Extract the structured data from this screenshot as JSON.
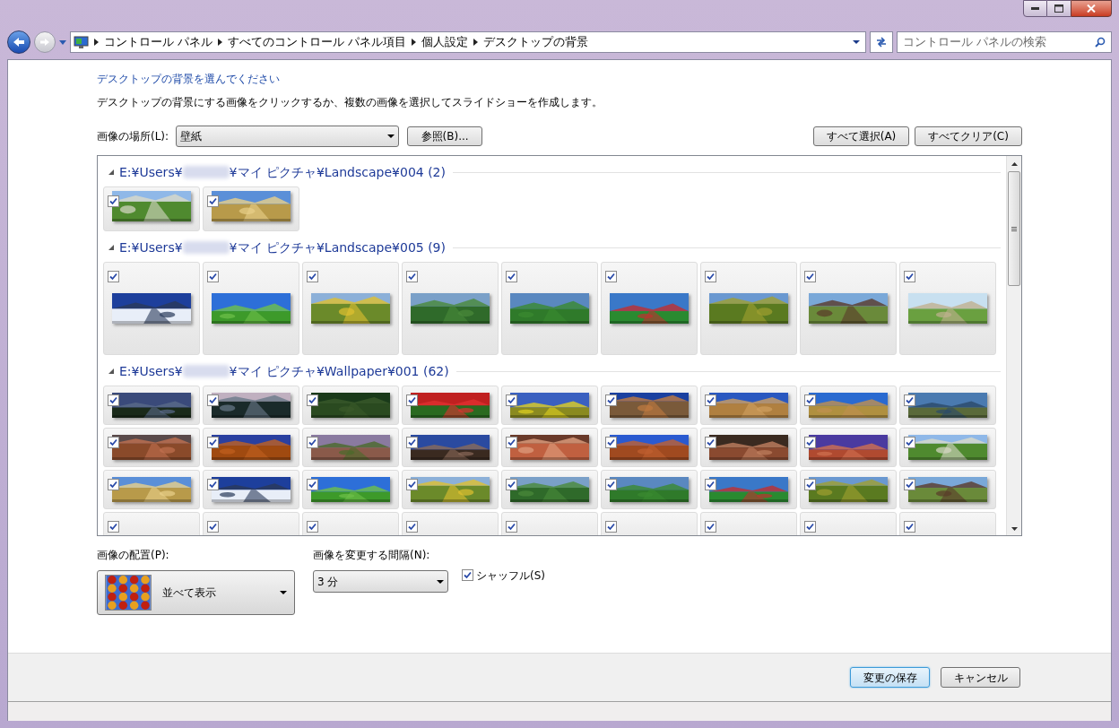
{
  "address_bar": {
    "breadcrumbs": [
      "コントロール パネル",
      "すべてのコントロール パネル項目",
      "個人設定",
      "デスクトップの背景"
    ]
  },
  "search": {
    "placeholder": "コントロール パネルの検索"
  },
  "heading": "デスクトップの背景を選んでください",
  "instructions": "デスクトップの背景にする画像をクリックするか、複数の画像を選択してスライドショーを作成します。",
  "location": {
    "label": "画像の場所(L):",
    "value": "壁紙",
    "browse": "参照(B)..."
  },
  "select_all": "すべて選択(A)",
  "clear_all": "すべてクリア(C)",
  "groups": [
    {
      "path_start": "E:¥Users¥",
      "path_end": "¥マイ ピクチャ¥Landscape¥004 (2)",
      "expanded": true,
      "kind": "short",
      "items": [
        {
          "checked": true,
          "kind": "thumb"
        },
        {
          "checked": true,
          "kind": "thumb"
        }
      ]
    },
    {
      "path_start": "E:¥Users¥",
      "path_end": "¥マイ ピクチャ¥Landscape¥005 (9)",
      "expanded": true,
      "kind": "tall",
      "items": [
        {
          "checked": true,
          "kind": "thumb"
        },
        {
          "checked": true,
          "kind": "thumb"
        },
        {
          "checked": true,
          "kind": "thumb"
        },
        {
          "checked": true,
          "kind": "thumb"
        },
        {
          "checked": true,
          "kind": "thumb"
        },
        {
          "checked": true,
          "kind": "thumb"
        },
        {
          "checked": true,
          "kind": "thumb"
        },
        {
          "checked": true,
          "kind": "thumb"
        },
        {
          "checked": true,
          "kind": "thumb"
        }
      ]
    },
    {
      "path_start": "E:¥Users¥",
      "path_end": "¥マイ ピクチャ¥Wallpaper¥001 (62)",
      "expanded": true,
      "kind": "compact",
      "items": [
        {
          "checked": true,
          "kind": "thumb"
        },
        {
          "checked": true,
          "kind": "thumb"
        },
        {
          "checked": true,
          "kind": "thumb"
        },
        {
          "checked": true,
          "kind": "thumb"
        },
        {
          "checked": true,
          "kind": "thumb"
        },
        {
          "checked": true,
          "kind": "thumb"
        },
        {
          "checked": true,
          "kind": "thumb"
        },
        {
          "checked": true,
          "kind": "thumb"
        },
        {
          "checked": true,
          "kind": "thumb"
        },
        {
          "checked": true,
          "kind": "thumb"
        },
        {
          "checked": true,
          "kind": "thumb"
        },
        {
          "checked": true,
          "kind": "thumb"
        },
        {
          "checked": true,
          "kind": "thumb"
        },
        {
          "checked": true,
          "kind": "thumb"
        },
        {
          "checked": true,
          "kind": "thumb"
        },
        {
          "checked": true,
          "kind": "thumb"
        },
        {
          "checked": true,
          "kind": "thumb"
        },
        {
          "checked": true,
          "kind": "thumb"
        },
        {
          "checked": true,
          "kind": "thumb"
        },
        {
          "checked": true,
          "kind": "thumb"
        },
        {
          "checked": true,
          "kind": "thumb"
        },
        {
          "checked": true,
          "kind": "thumb"
        },
        {
          "checked": true,
          "kind": "thumb"
        },
        {
          "checked": true,
          "kind": "thumb"
        },
        {
          "checked": true,
          "kind": "thumb"
        },
        {
          "checked": true,
          "kind": "thumb"
        },
        {
          "checked": true,
          "kind": "thumb"
        },
        {
          "checked": true,
          "kind": "edge"
        },
        {
          "checked": true,
          "kind": "edge"
        },
        {
          "checked": true,
          "kind": "edge"
        },
        {
          "checked": true,
          "kind": "edge"
        },
        {
          "checked": true,
          "kind": "edge"
        },
        {
          "checked": true,
          "kind": "edge"
        },
        {
          "checked": true,
          "kind": "edge"
        },
        {
          "checked": true,
          "kind": "edge"
        },
        {
          "checked": true,
          "kind": "edge"
        }
      ]
    }
  ],
  "position": {
    "label": "画像の配置(P):",
    "value": "並べて表示"
  },
  "interval": {
    "label": "画像を変更する間隔(N):",
    "value": "3 分"
  },
  "shuffle": {
    "label": "シャッフル(S)",
    "checked": true
  },
  "buttons": [
    {
      "label": "変更の保存",
      "default": true
    },
    {
      "label": "キャンセル",
      "default": false
    }
  ]
}
